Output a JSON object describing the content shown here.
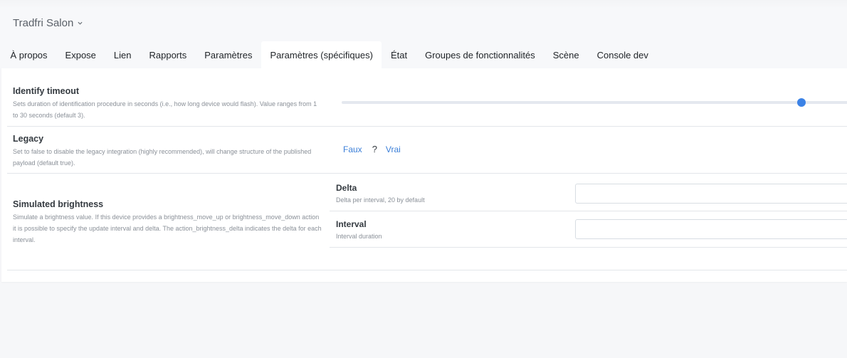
{
  "header": {
    "device_title": "Tradfri Salon"
  },
  "tabs": [
    {
      "label": "À propos"
    },
    {
      "label": "Expose"
    },
    {
      "label": "Lien"
    },
    {
      "label": "Rapports"
    },
    {
      "label": "Paramètres"
    },
    {
      "label": "Paramètres (spécifiques)",
      "active": true
    },
    {
      "label": "État"
    },
    {
      "label": "Groupes de fonctionnalités"
    },
    {
      "label": "Scène"
    },
    {
      "label": "Console dev"
    }
  ],
  "settings": {
    "identify_timeout": {
      "title": "Identify timeout",
      "description": "Sets duration of identification procedure in seconds (i.e., how long device would flash). Value ranges from 1 to 30 seconds (default 3).",
      "slider": {
        "min": 1,
        "max": 30,
        "value": 27
      },
      "accent_color": "#3b82e6"
    },
    "legacy": {
      "title": "Legacy",
      "description": "Set to false to disable the legacy integration (highly recommended), will change structure of the published payload (default true).",
      "false_label": "Faux",
      "unknown_label": "?",
      "true_label": "Vrai"
    },
    "simulated_brightness": {
      "title": "Simulated brightness",
      "description": "Simulate a brightness value. If this device provides a brightness_move_up or brightness_move_down action it is possible to specify the update interval and delta. The action_brightness_delta indicates the delta for each interval.",
      "delta": {
        "title": "Delta",
        "description": "Delta per interval, 20 by default",
        "value": ""
      },
      "interval": {
        "title": "Interval",
        "description": "Interval duration",
        "value": ""
      }
    }
  }
}
